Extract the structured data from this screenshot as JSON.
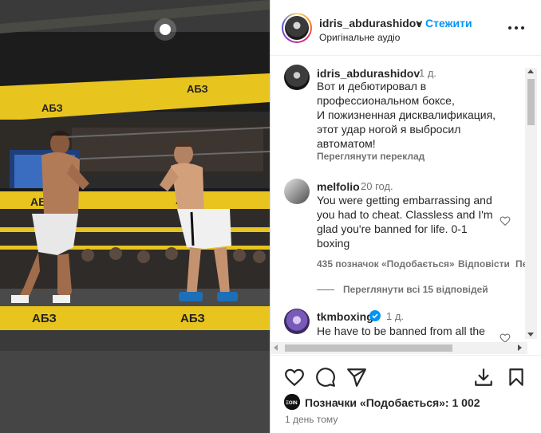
{
  "post": {
    "username": "idris_abdurashidov",
    "separator": "•",
    "follow_label": "Стежити",
    "audio_label": "Оригінальне аудіо",
    "more_icon": "more-horizontal-icon"
  },
  "media": {
    "banner_text": "АБЗ",
    "description": ""
  },
  "caption": {
    "username": "idris_abdurashidov",
    "time": "1 д.",
    "text": "Вот и дебютировал в\nпрофессиональном боксе,\nИ пожизненная дисквалификация,\nэтот удар ногой я выбросил\nавтоматом!",
    "translate_label": "Переглянути переклад"
  },
  "comments": [
    {
      "username": "melfolio",
      "time": "20 год.",
      "text": "You were getting embarrassing and\nyou had to cheat. Classless and I'm\nglad you're banned for life. 0-1\nboxing",
      "likes_label": "435 позначок «Подобається»",
      "reply_label": "Відповісти",
      "more_label": "Пе",
      "replies_label": "Переглянути всі 15 відповідей"
    },
    {
      "username": "tkmboxing",
      "verified": true,
      "time": "1 д.",
      "text": "He have to be banned from all the"
    }
  ],
  "actions": {
    "like_icon": "heart-icon",
    "comment_icon": "comment-icon",
    "share_icon": "send-icon",
    "download_icon": "download-icon",
    "save_icon": "bookmark-icon",
    "likes_text": "Позначки «Подобається»: 1 002",
    "timestamp": "1 день тому"
  },
  "colors": {
    "accent": "#0095f6",
    "text": "#262626",
    "muted": "#737373",
    "ring_yellow": "#f2c524"
  }
}
